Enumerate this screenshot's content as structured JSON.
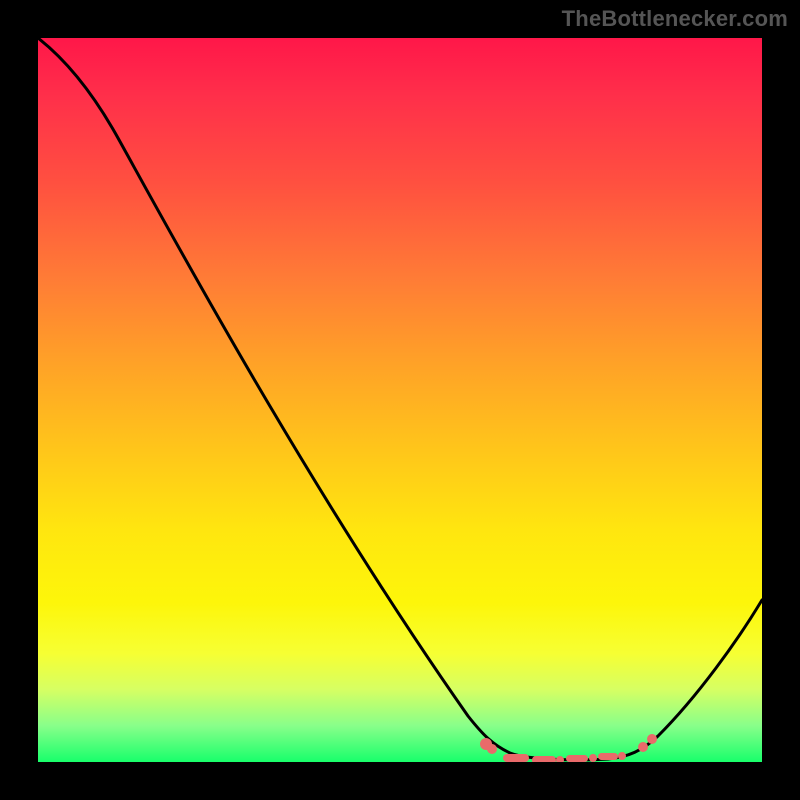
{
  "attribution": "TheBottlenecker.com",
  "chart_data": {
    "type": "line",
    "title": "",
    "xlabel": "",
    "ylabel": "",
    "xlim": [
      0,
      100
    ],
    "ylim": [
      0,
      100
    ],
    "legend": false,
    "grid": false,
    "notes": "Axes unlabeled; background is a vertical gradient from red (top / high bottleneck) to green (bottom / zero bottleneck). Curve is a V-shaped bottleneck curve: steep descending left leg, flat minimum segment, rising right leg.",
    "series": [
      {
        "name": "bottleneck-curve",
        "x": [
          0,
          6,
          12,
          18,
          24,
          30,
          36,
          42,
          48,
          52,
          56,
          61,
          65,
          70,
          75,
          80,
          85,
          90,
          95,
          100
        ],
        "y": [
          100,
          96,
          90,
          82,
          72,
          62,
          52,
          42,
          31,
          23,
          15,
          8,
          3,
          0.5,
          0.5,
          0.8,
          3,
          10,
          20,
          32
        ]
      }
    ],
    "markers": {
      "type": "range-band",
      "x_start": 62,
      "x_end": 84,
      "y": 1,
      "color": "#e96a6a"
    }
  }
}
